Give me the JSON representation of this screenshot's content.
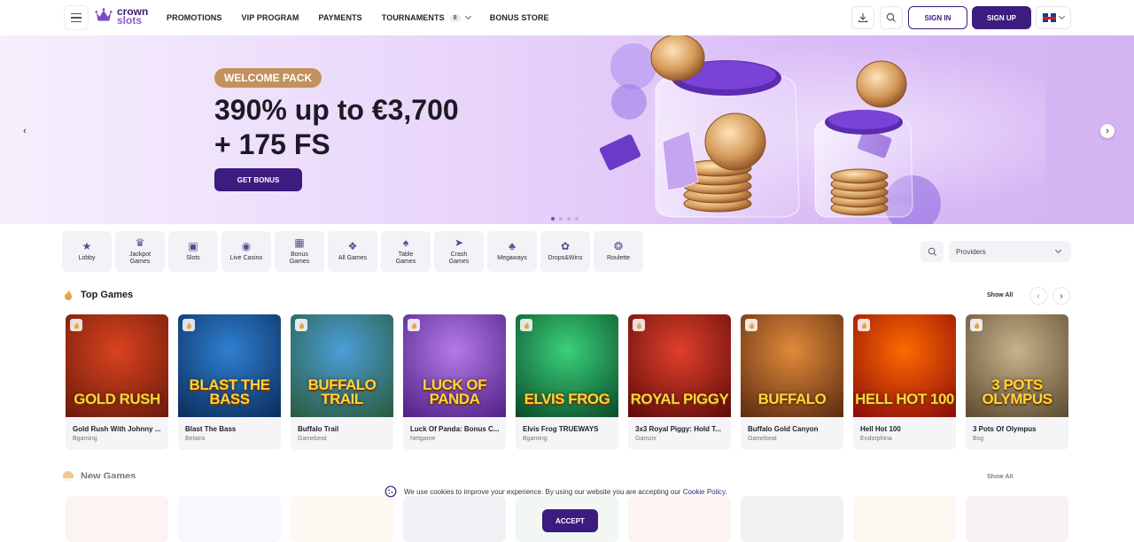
{
  "header": {
    "logo_line1": "crown",
    "logo_line2": "slots",
    "nav": [
      {
        "label": "PROMOTIONS"
      },
      {
        "label": "VIP PROGRAM"
      },
      {
        "label": "PAYMENTS"
      },
      {
        "label": "TOURNAMENTS",
        "badge": "8"
      },
      {
        "label": "BONUS STORE"
      }
    ],
    "sign_in": "SIGN IN",
    "sign_up": "SIGN UP"
  },
  "hero": {
    "pill": "WELCOME PACK",
    "title_line1": "390% up to €3,700",
    "title_line2": "+ 175 FS",
    "button": "GET BONUS"
  },
  "categories": [
    {
      "label": "Lobby",
      "icon": "star-icon"
    },
    {
      "label": "Jackpot Games",
      "icon": "jackpot-icon"
    },
    {
      "label": "Slots",
      "icon": "seven-icon"
    },
    {
      "label": "Live Casino",
      "icon": "live-casino-icon"
    },
    {
      "label": "Bonus Games",
      "icon": "gift-icon"
    },
    {
      "label": "All Games",
      "icon": "all-games-icon"
    },
    {
      "label": "Table Games",
      "icon": "cards-icon"
    },
    {
      "label": "Crash Games",
      "icon": "rocket-icon"
    },
    {
      "label": "Megaways",
      "icon": "clover-icon"
    },
    {
      "label": "Drops&Wins",
      "icon": "drops-icon"
    },
    {
      "label": "Roulette",
      "icon": "roulette-icon"
    }
  ],
  "providers_placeholder": "Providers",
  "top_games": {
    "title": "Top Games",
    "show_all": "Show All",
    "games": [
      {
        "name": "Gold Rush With Johnny ...",
        "provider": "Bgaming",
        "logo": "GOLD RUSH",
        "bg1": "#d9431e",
        "bg2": "#6a1a0b"
      },
      {
        "name": "Blast The Bass",
        "provider": "Belatra",
        "logo": "BLAST THE BASS",
        "bg1": "#2f7fd1",
        "bg2": "#0b2c5a"
      },
      {
        "name": "Buffalo Trail",
        "provider": "Gamebeat",
        "logo": "BUFFALO TRAIL",
        "bg1": "#4a9ed8",
        "bg2": "#2a5a3a"
      },
      {
        "name": "Luck Of Panda: Bonus C...",
        "provider": "Netgame",
        "logo": "LUCK OF PANDA",
        "bg1": "#b57be6",
        "bg2": "#4e1f86"
      },
      {
        "name": "Elvis Frog TRUEWAYS",
        "provider": "Bgaming",
        "logo": "ELVIS FROG",
        "bg1": "#3bd07a",
        "bg2": "#0a4a28"
      },
      {
        "name": "3x3 Royal Piggy: Hold T...",
        "provider": "Gamzix",
        "logo": "ROYAL PIGGY",
        "bg1": "#e0402a",
        "bg2": "#5c0a0a"
      },
      {
        "name": "Buffalo Gold Canyon",
        "provider": "Gamebeat",
        "logo": "BUFFALO",
        "bg1": "#e08a3a",
        "bg2": "#5a2a10"
      },
      {
        "name": "Hell Hot 100",
        "provider": "Endorphina",
        "logo": "HELL HOT 100",
        "bg1": "#ff6a00",
        "bg2": "#8a0a0a"
      },
      {
        "name": "3 Pots Of Olympus",
        "provider": "Bsg",
        "logo": "3 POTS OLYMPUS",
        "bg1": "#c8b38a",
        "bg2": "#5a4a30"
      }
    ]
  },
  "new_games": {
    "title": "New Games",
    "show_all": "Show All"
  },
  "cookie": {
    "text": "We use cookies to improve your experience. By using our website you are accepting our",
    "link": "Cookie Policy.",
    "accept": "ACCEPT"
  },
  "colors": {
    "brand": "#3c1c7e",
    "pill": "#c2915e"
  }
}
